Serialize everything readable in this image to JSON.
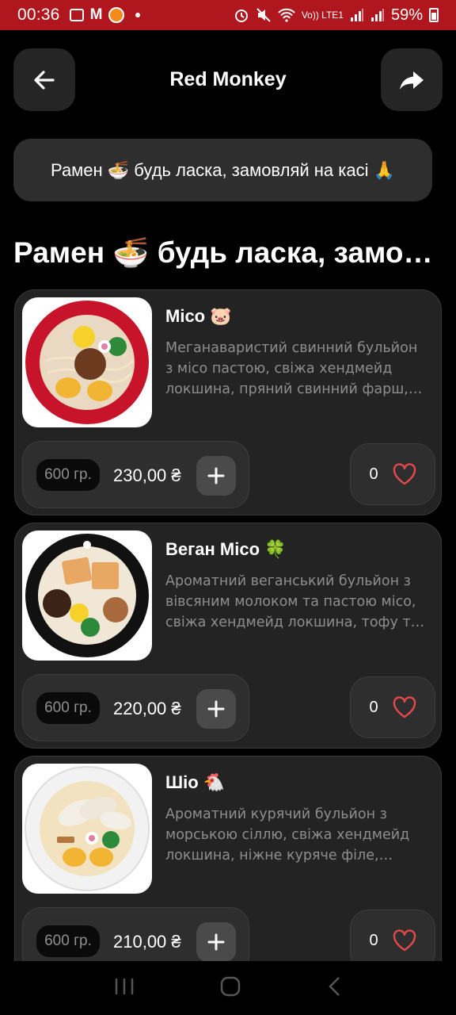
{
  "status_bar": {
    "time": "00:36",
    "network": "Vo)) LTE1",
    "battery": "59%"
  },
  "header": {
    "title": "Red Monkey",
    "back_icon": "arrow-left-icon",
    "share_icon": "share-icon"
  },
  "banner": {
    "text": "Рамен 🍜 будь ласка, замовляй на касі 🙏"
  },
  "section": {
    "title": "Рамен 🍜 будь ласка, замовляй на касі 🙏"
  },
  "items": [
    {
      "name": "Місо 🐷",
      "description": "Меганаваристий свинний бульйон з місо пастою, свіжа хендмейд локшина, пряний свинний фарш, яйце та овочі",
      "weight": "600 гр.",
      "price": "230,00 ₴",
      "likes": "0",
      "bowl_color": "#c8142a"
    },
    {
      "name": "Веган Місо 🍀",
      "description": "Ароматний веганський бульйон з вівсяним молоком та пастою місо, свіжа хендмейд локшина, тофу та овочі",
      "weight": "600 гр.",
      "price": "220,00 ₴",
      "likes": "0",
      "bowl_color": "#111111"
    },
    {
      "name": "Шіо 🐔",
      "description": "Ароматний курячий бульйон з морською сіллю, свіжа хендмейд локшина, ніжне куряче філе, мариноване яйце",
      "weight": "600 гр.",
      "price": "210,00 ₴",
      "likes": "0",
      "bowl_color": "#f2f2f2"
    }
  ],
  "colors": {
    "accent": "#e5484d",
    "status_bar": "#b0161d",
    "card_bg": "#232323"
  }
}
